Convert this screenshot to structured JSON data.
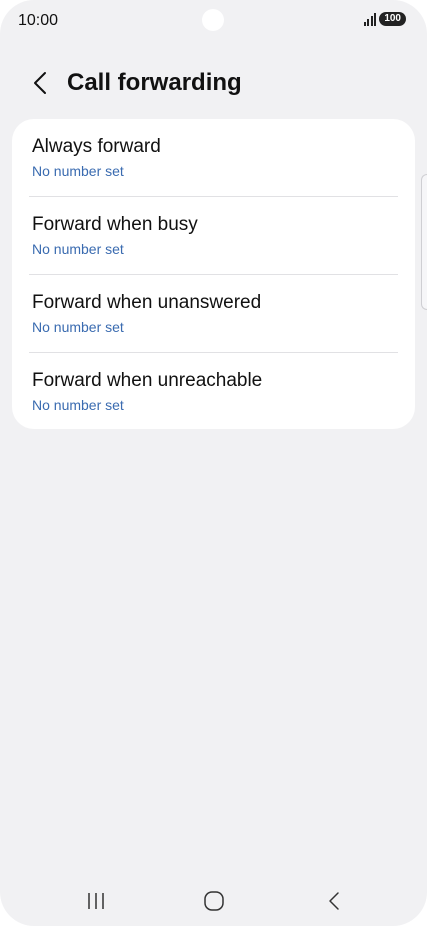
{
  "status_bar": {
    "time": "10:00",
    "battery": "100"
  },
  "header": {
    "title": "Call forwarding",
    "back_icon": "chevron-left-icon"
  },
  "items": [
    {
      "title": "Always forward",
      "subtitle": "No number set"
    },
    {
      "title": "Forward when busy",
      "subtitle": "No number set"
    },
    {
      "title": "Forward when unanswered",
      "subtitle": "No number set"
    },
    {
      "title": "Forward when unreachable",
      "subtitle": "No number set"
    }
  ],
  "nav_bar": {
    "recents_icon": "recents-icon",
    "home_icon": "home-icon",
    "back_icon": "back-icon"
  },
  "colors": {
    "background": "#f1f1f3",
    "card": "#ffffff",
    "subtitle": "#3a6bb0"
  }
}
